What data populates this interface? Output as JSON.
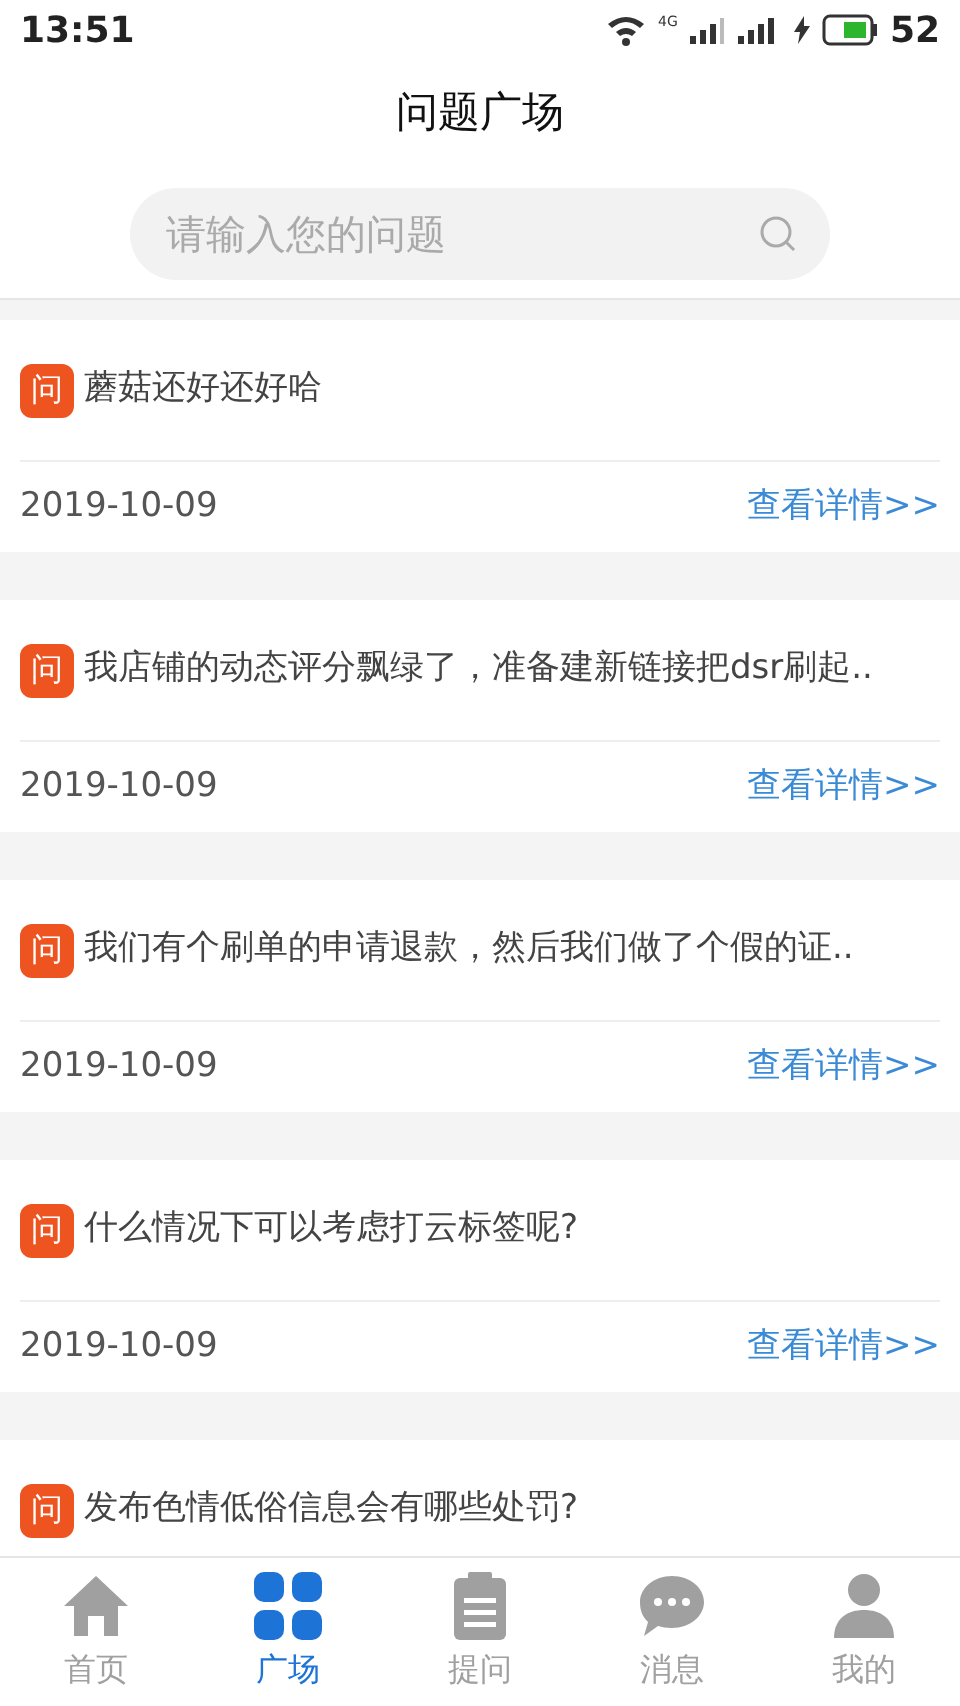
{
  "status_bar": {
    "time": "13:51",
    "network": "4G",
    "battery": "52"
  },
  "header": {
    "title": "问题广场"
  },
  "search": {
    "placeholder": "请输入您的问题"
  },
  "questions": [
    {
      "badge": "问",
      "text": "蘑菇还好还好哈",
      "date": "2019-10-09",
      "link": "查看详情>>"
    },
    {
      "badge": "问",
      "text": "我店铺的动态评分飘绿了，准备建新链接把dsr刷起..",
      "date": "2019-10-09",
      "link": "查看详情>>"
    },
    {
      "badge": "问",
      "text": "我们有个刷单的申请退款，然后我们做了个假的证..",
      "date": "2019-10-09",
      "link": "查看详情>>"
    },
    {
      "badge": "问",
      "text": "什么情况下可以考虑打云标签呢?",
      "date": "2019-10-09",
      "link": "查看详情>>"
    },
    {
      "badge": "问",
      "text": "发布色情低俗信息会有哪些处罚?"
    }
  ],
  "nav": [
    {
      "kind": "home",
      "label": "首页",
      "selected": false
    },
    {
      "kind": "square",
      "label": "广场",
      "selected": true
    },
    {
      "kind": "ask",
      "label": "提问",
      "selected": false
    },
    {
      "kind": "message",
      "label": "消息",
      "selected": false
    },
    {
      "kind": "me",
      "label": "我的",
      "selected": false
    }
  ]
}
